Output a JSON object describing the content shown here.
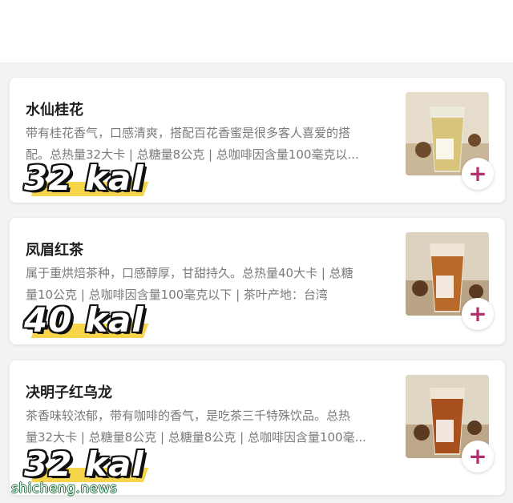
{
  "items": [
    {
      "name": "水仙桂花",
      "desc_line1": "带有桂花香气，口感清爽，搭配百花香蜜是很多客人喜爱的搭",
      "desc_line2": "配。总热量32大卡 | 总糖量8公克 | 总咖啡因含量100毫克以...",
      "kal": "32 kal",
      "drink_color": "#d8c47a",
      "add_icon": "+"
    },
    {
      "name": "凤眉红茶",
      "desc_line1": "属于重烘焙茶种，口感醇厚，甘甜持久。总热量40大卡 | 总糖",
      "desc_line2": "量10公克 | 总咖啡因含量100毫克以下 | 茶叶产地：台湾",
      "kal": "40 kal",
      "drink_color": "#b86a2a",
      "add_icon": "+"
    },
    {
      "name": "决明子红乌龙",
      "desc_line1": "茶香味较浓郁，带有咖啡的香气，是吃茶三千特殊饮品。总热",
      "desc_line2": "量32大卡 | 总糖量8公克 | 总糖量8公克 | 总咖啡因含量100毫...",
      "kal": "32 kal",
      "drink_color": "#a8501e",
      "add_icon": "+"
    }
  ],
  "watermark": "shicheng.news",
  "accent": "#b0316d",
  "highlight": "#f7d54a"
}
